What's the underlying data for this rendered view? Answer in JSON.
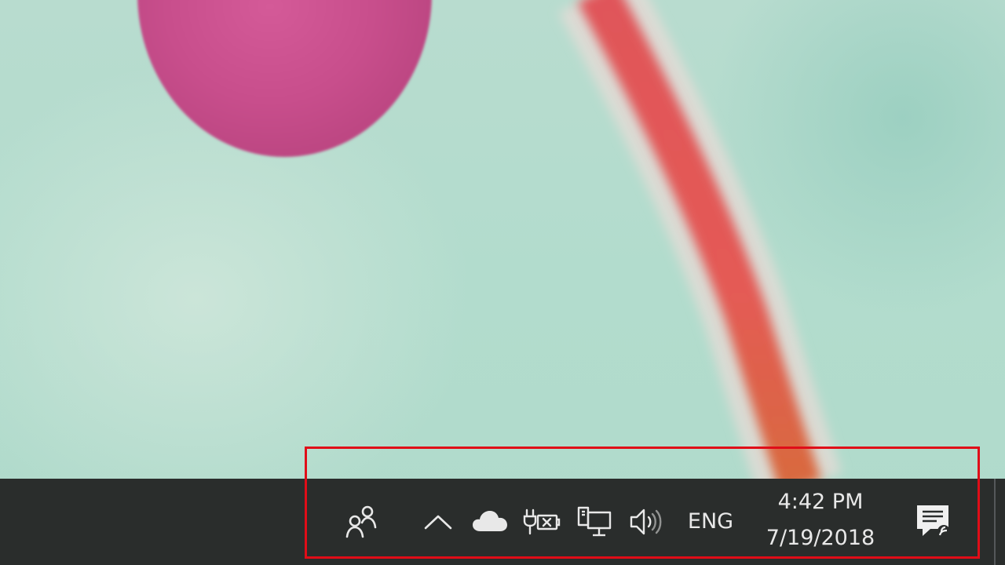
{
  "desktop": {
    "wallpaper": "pink flower petal with red stem on mint background"
  },
  "taskbar": {
    "background_color": "#2a2d2c",
    "tray_icons": [
      {
        "name": "people-icon"
      },
      {
        "name": "show-hidden-icons-chevron"
      },
      {
        "name": "onedrive-cloud-icon"
      },
      {
        "name": "power-battery-icon"
      },
      {
        "name": "network-icon"
      },
      {
        "name": "volume-icon"
      }
    ],
    "language": "ENG",
    "clock": {
      "time": "4:42 PM",
      "date": "7/19/2018"
    },
    "action_center_icon": "action-center-icon"
  },
  "annotation": {
    "highlight_color": "#e00d18"
  }
}
